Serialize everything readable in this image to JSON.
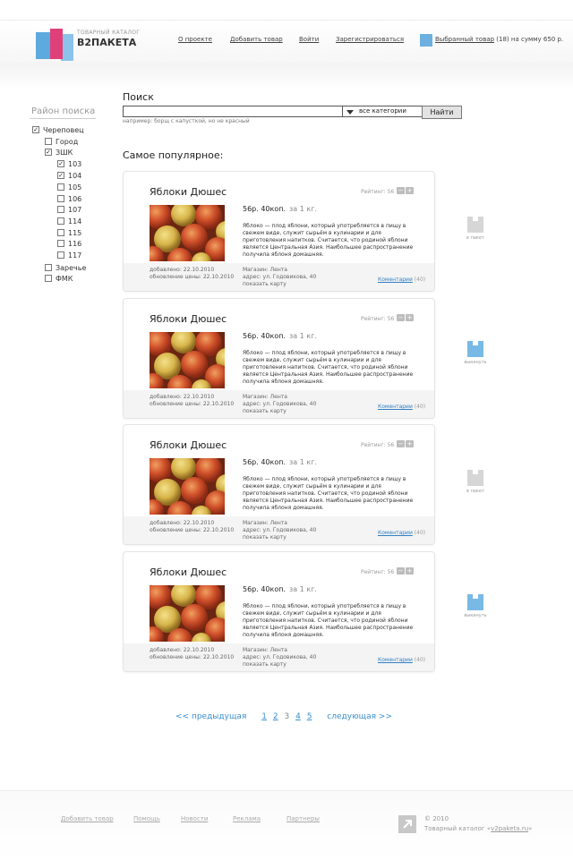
{
  "header": {
    "logo_small": "ТОВАРНЫЙ КАТАЛОГ",
    "logo_big": "В2ПАКЕТА",
    "nav": [
      "О проекте",
      "Добавить товар",
      "Войти",
      "Зарегистрироваться"
    ],
    "basket_link": "Выбранный товар",
    "basket_rest": " (18) на сумму 650 р."
  },
  "sidebar": {
    "title": "Район поиска",
    "items": [
      {
        "label": "Череповец",
        "checked": true
      },
      {
        "label": "Город",
        "checked": false
      },
      {
        "label": "ЗШК",
        "checked": true
      },
      {
        "label": "103",
        "checked": true
      },
      {
        "label": "104",
        "checked": true
      },
      {
        "label": "105",
        "checked": false
      },
      {
        "label": "106",
        "checked": false
      },
      {
        "label": "107",
        "checked": false
      },
      {
        "label": "114",
        "checked": false
      },
      {
        "label": "115",
        "checked": false
      },
      {
        "label": "116",
        "checked": false
      },
      {
        "label": "117",
        "checked": false
      },
      {
        "label": "Заречье",
        "checked": false
      },
      {
        "label": "ФМК",
        "checked": false
      }
    ]
  },
  "search": {
    "title": "Поиск",
    "value": "",
    "category": "все категории",
    "button": "Найти",
    "hint": "например: борщ с капусткой, но не красный"
  },
  "popular_title": "Самое популярное:",
  "cards": [
    {
      "title": "Яблоки Дюшес",
      "rating": "Рейтинг: 56",
      "minus": "−",
      "plus": "+",
      "price": "56р. 40коп.",
      "unit": "за 1 кг.",
      "desc": "Яблоко — плод яблони, который употребляется в пищу в свежем виде, служит сырьём в кулинарии и для приготовления напитков. Считается, что родиной яблони является Центральная Азия. Наибольшее распространение получила яблоня домашняя.",
      "added": "добавлено: 22.10.2010",
      "updated": "обновление цены: 22.10.2010",
      "shop": "Магазин: Лента",
      "address": "адрес: ул. Годовикова, 40",
      "map": "показать карту",
      "comments_link": "Коментарии",
      "comments_count": "(40)",
      "action": "в пакет",
      "action_color": "#d6d6d6"
    },
    {
      "title": "Яблоки Дюшес",
      "rating": "Рейтинг: 56",
      "minus": "−",
      "plus": "+",
      "price": "56р. 40коп.",
      "unit": "за 1 кг.",
      "desc": "Яблоко — плод яблони, который употребляется в пищу в свежем виде, служит сырьём в кулинарии и для приготовления напитков. Считается, что родиной яблони является Центральная Азия. Наибольшее распространение получила яблоня домашняя.",
      "added": "добавлено: 22.10.2010",
      "updated": "обновление цены: 22.10.2010",
      "shop": "Магазин: Лента",
      "address": "адрес: ул. Годовикова, 40",
      "map": "показать карту",
      "comments_link": "Коментарии",
      "comments_count": "(40)",
      "action": "выкинуть",
      "action_color": "#79b9e5"
    },
    {
      "title": "Яблоки Дюшес",
      "rating": "Рейтинг: 56",
      "minus": "−",
      "plus": "+",
      "price": "56р. 40коп.",
      "unit": "за 1 кг.",
      "desc": "Яблоко — плод яблони, который употребляется в пищу в свежем виде, служит сырьём в кулинарии и для приготовления напитков. Считается, что родиной яблони является Центральная Азия. Наибольшее распространение получила яблоня домашняя.",
      "added": "добавлено: 22.10.2010",
      "updated": "обновление цены: 22.10.2010",
      "shop": "Магазин: Лента",
      "address": "адрес: ул. Годовикова, 40",
      "map": "показать карту",
      "comments_link": "Коментарии",
      "comments_count": "(40)",
      "action": "в пакет",
      "action_color": "#d6d6d6"
    },
    {
      "title": "Яблоки Дюшес",
      "rating": "Рейтинг: 56",
      "minus": "−",
      "plus": "+",
      "price": "56р. 40коп.",
      "unit": "за 1 кг.",
      "desc": "Яблоко — плод яблони, который употребляется в пищу в свежем виде, служит сырьём в кулинарии и для приготовления напитков. Считается, что родиной яблони является Центральная Азия. Наибольшее распространение получила яблоня домашняя.",
      "added": "добавлено: 22.10.2010",
      "updated": "обновление цены: 22.10.2010",
      "shop": "Магазин: Лента",
      "address": "адрес: ул. Годовикова, 40",
      "map": "показать карту",
      "comments_link": "Коментарии",
      "comments_count": "(40)",
      "action": "выкинуть",
      "action_color": "#79b9e5"
    }
  ],
  "pager": {
    "prev": "<< предыдущая",
    "pages": [
      "1",
      "2",
      "3",
      "4",
      "5"
    ],
    "current": "3",
    "next": "следующая >>"
  },
  "footer": {
    "links": [
      "Добавить товар",
      "Помощь",
      "Новости",
      "Реклама",
      "Партнеры"
    ],
    "copyright": "© 2010",
    "catalog_prefix": "Товарный каталог «",
    "catalog_link": "v2paketa.ru",
    "catalog_suffix": "»"
  }
}
